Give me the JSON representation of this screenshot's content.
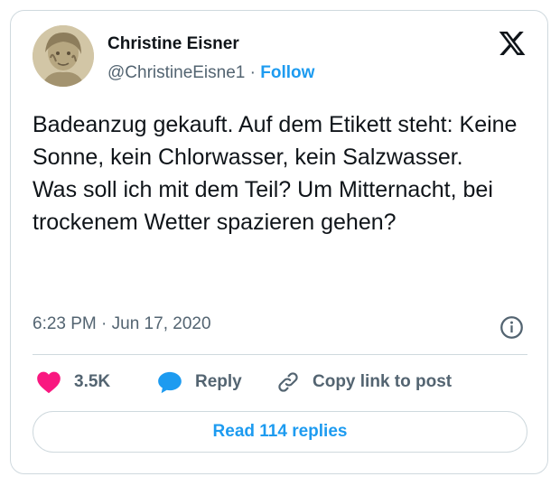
{
  "author": {
    "name": "Christine Eisner",
    "handle": "@ChristineEisne1",
    "separator": "·",
    "follow_label": "Follow"
  },
  "tweet": {
    "paragraph_1": "Badeanzug gekauft. Auf dem Etikett steht: Keine Sonne, kein Chlorwasser, kein Salzwasser.",
    "paragraph_2": "Was soll ich mit dem Teil? Um Mitternacht, bei trockenem Wetter spazieren gehen?",
    "timestamp": "6:23 PM · Jun 17, 2020"
  },
  "actions": {
    "like_count": "3.5K",
    "reply_label": "Reply",
    "copy_link_label": "Copy link to post"
  },
  "read_replies_label": "Read 114 replies",
  "icons": {
    "logo": "x-logo-icon",
    "info": "info-icon",
    "like": "heart-icon",
    "reply": "speech-bubble-icon",
    "link": "link-icon"
  },
  "colors": {
    "accent": "#1d9bf0",
    "like": "#f91880",
    "text": "#0f1419",
    "muted": "#536471",
    "border": "#cfd9de"
  }
}
